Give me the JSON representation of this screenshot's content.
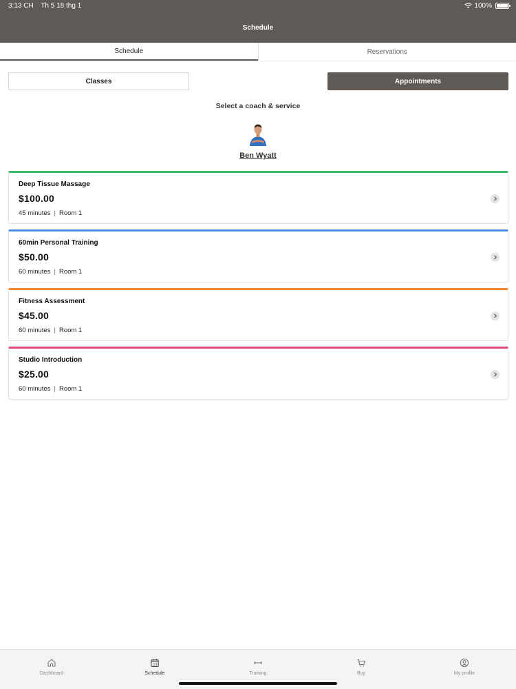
{
  "status_bar": {
    "time": "3:13 CH",
    "date": "Th 5 18 thg 1",
    "battery": "100%"
  },
  "header": {
    "title": "Schedule"
  },
  "segments": {
    "schedule": "Schedule",
    "reservations": "Reservations"
  },
  "toggle": {
    "classes": "Classes",
    "appointments": "Appointments"
  },
  "select_label": "Select a coach & service",
  "coach": {
    "name": "Ben Wyatt"
  },
  "services": [
    {
      "name": "Deep Tissue Massage",
      "price": "$100.00",
      "duration": "45 minutes",
      "room": "Room 1",
      "color": "#3cba6f"
    },
    {
      "name": "60min Personal Training",
      "price": "$50.00",
      "duration": "60 minutes",
      "room": "Room 1",
      "color": "#4a8fe0"
    },
    {
      "name": "Fitness Assessment",
      "price": "$45.00",
      "duration": "60 minutes",
      "room": "Room 1",
      "color": "#ea8a3a"
    },
    {
      "name": "Studio Introduction",
      "price": "$25.00",
      "duration": "60 minutes",
      "room": "Room 1",
      "color": "#e0487a"
    }
  ],
  "tab_bar": {
    "tabs": [
      {
        "label": "Dashboard",
        "icon": "home-icon"
      },
      {
        "label": "Schedule",
        "icon": "calendar-icon"
      },
      {
        "label": "Training",
        "icon": "dumbbell-icon"
      },
      {
        "label": "Buy",
        "icon": "cart-icon"
      },
      {
        "label": "My profile",
        "icon": "profile-icon"
      }
    ]
  },
  "colors": {
    "header_bg": "#5f5a56",
    "accent": "#5f5a56"
  }
}
